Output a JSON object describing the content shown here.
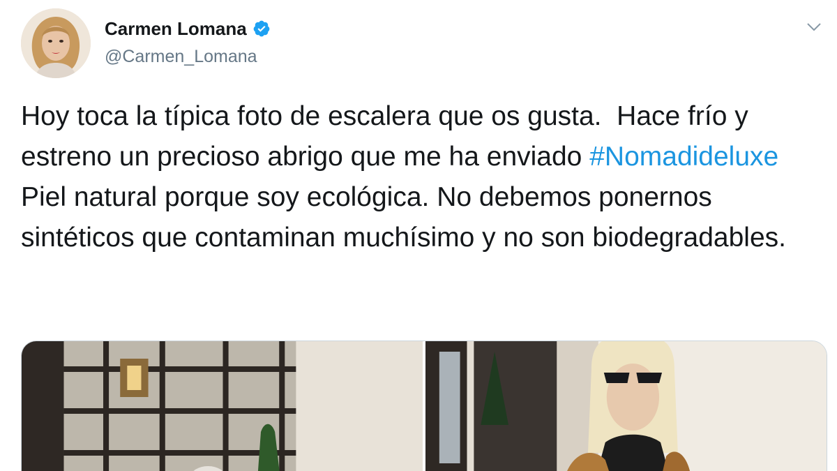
{
  "author": {
    "display_name": "Carmen Lomana",
    "handle": "@Carmen_Lomana",
    "verified": true
  },
  "tweet": {
    "text_part1": "Hoy toca la típica foto de escalera que os gusta.  Hace frío y estreno un precioso abrigo que me ha enviado ",
    "hashtag": "#Nomadideluxe",
    "text_part2": "  Piel natural porque soy ecológica. No debemos ponernos sintéticos que contaminan muchísimo y no son biodegradables."
  },
  "icons": {
    "verified": "verified-badge-icon",
    "menu": "chevron-down-icon"
  },
  "colors": {
    "link": "#1b95e0",
    "verified": "#1da1f2",
    "text": "#14171a",
    "secondary": "#657786"
  }
}
